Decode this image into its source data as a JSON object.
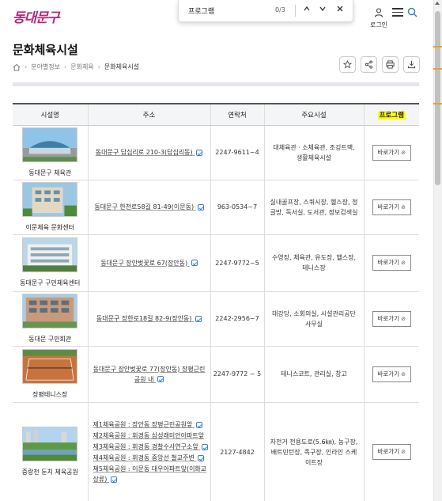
{
  "header": {
    "logo": "동대문구",
    "login_label": "로그인"
  },
  "find_bar": {
    "query": "프로그램",
    "count": "0/3"
  },
  "page": {
    "title": "문화체육시설",
    "breadcrumb": [
      "분야별정보",
      "문화체육",
      "문화체육시설"
    ]
  },
  "table": {
    "headers": [
      "시설명",
      "주소",
      "연락처",
      "주요시설",
      "프로그램"
    ],
    "button_label": "바로가기",
    "rows": [
      {
        "name": "동대문구 체육관",
        "address": "동대문구 답십리로 210-3(답십리동)",
        "phone": "2247-9611~4",
        "facilities": "대체육관ㆍ소체육관, 조깅트랙, 생활체육시설"
      },
      {
        "name": "이문체육 문화센터",
        "address": "동대문구 한천로58길 81-49(이문동)",
        "phone": "963-0534~7",
        "facilities": "실내골프장, 스쿼시장, 헬스장, 정글방, 독서실, 도서관, 정보검색실"
      },
      {
        "name": "동대문구 구민체육센터",
        "address": "동대문구 장안벚꽃로 67(장안동)",
        "phone": "2247-9772~5",
        "facilities": "수영장, 체육관, 유도장, 헬스장, 테니스장"
      },
      {
        "name": "동대문 구민회관",
        "address": "동대문구 장한로18길 82-9(장안동)",
        "phone": "2242-2956~7",
        "facilities": "대강당, 소회의실, 시설관리공단 사무실"
      },
      {
        "name": "장평테니스장",
        "address": "동대문구 장안벚꽃로 77(장안동) 장평근린공원 내",
        "phone": "2247-9772 ~ 5",
        "facilities": "테니스코트, 관리실, 창고"
      },
      {
        "name": "중랑천 둔치 체육공원",
        "address_list": [
          "제1체육공원 : 장안동 장평근린공원앞",
          "제2체육공원 : 휘경동 삼성래미안아파트앞",
          "제3체육공원 : 휘경동 경찰수사연구소앞",
          "제4체육공원 : 휘경동 중앙선 철교주변",
          "제5체육공원 : 이문동 대우아파트앞(이화교상류)"
        ],
        "phone": "2127-4842",
        "facilities": "자전거 전용도로(5.6㎞), 농구장, 배트민턴장, 족구장, 인라인 스케이트장"
      }
    ]
  }
}
